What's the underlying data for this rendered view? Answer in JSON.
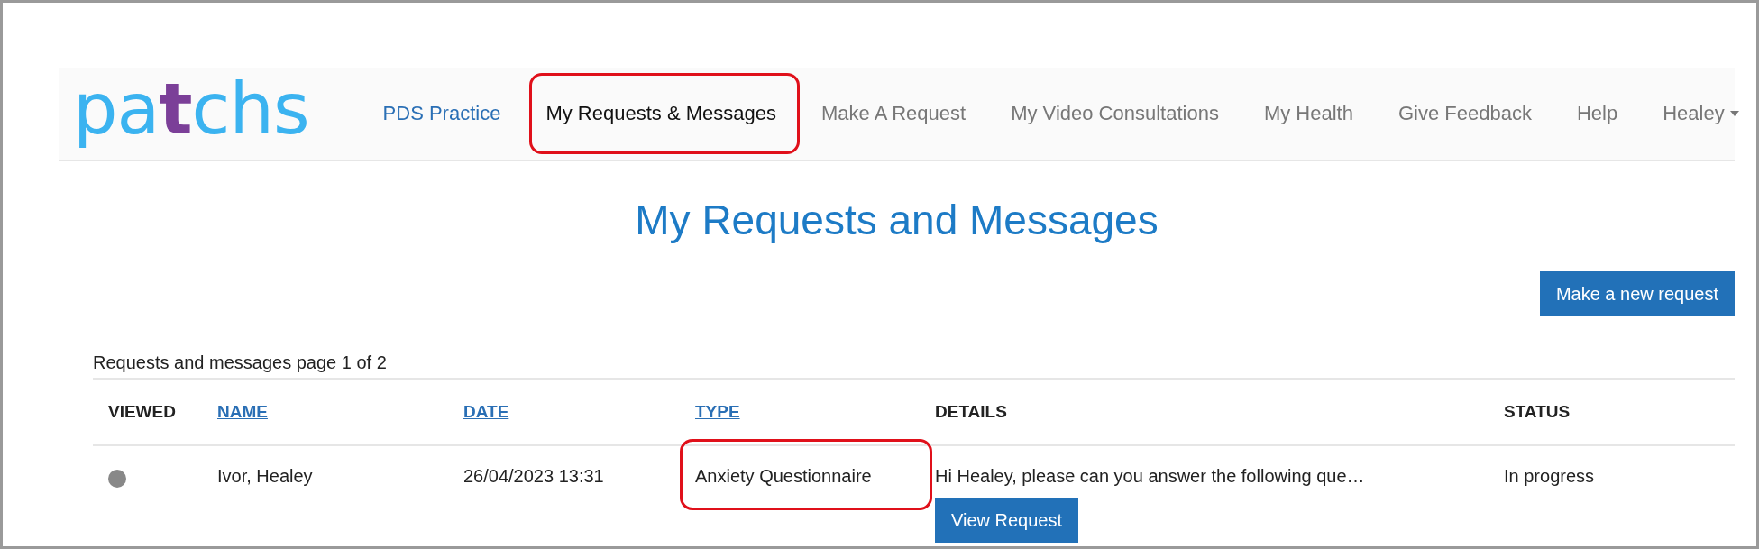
{
  "logo": {
    "parts": [
      "pa",
      "t",
      "chs"
    ]
  },
  "nav": [
    {
      "label": "PDS Practice",
      "kind": "practice",
      "selected": false,
      "highlighted": false
    },
    {
      "label": "My Requests & Messages",
      "kind": "link",
      "selected": true,
      "highlighted": true
    },
    {
      "label": "Make A Request",
      "kind": "link",
      "selected": false,
      "highlighted": false
    },
    {
      "label": "My Video Consultations",
      "kind": "link",
      "selected": false,
      "highlighted": false
    },
    {
      "label": "My Health",
      "kind": "link",
      "selected": false,
      "highlighted": false
    },
    {
      "label": "Give Feedback",
      "kind": "link",
      "selected": false,
      "highlighted": false
    },
    {
      "label": "Help",
      "kind": "link",
      "selected": false,
      "highlighted": false
    },
    {
      "label": "Healey",
      "kind": "dropdown",
      "selected": false,
      "highlighted": false
    }
  ],
  "page_title": "My Requests and Messages",
  "new_request_button": "Make a new request",
  "page_info": "Requests and messages page 1 of 2",
  "table": {
    "columns": [
      {
        "label": "VIEWED",
        "sortable": false
      },
      {
        "label": "NAME",
        "sortable": true
      },
      {
        "label": "DATE",
        "sortable": true
      },
      {
        "label": "TYPE",
        "sortable": true
      },
      {
        "label": "DETAILS",
        "sortable": false
      },
      {
        "label": "STATUS",
        "sortable": false
      }
    ],
    "rows": [
      {
        "color": "#888888",
        "name": "Ivor, Healey",
        "date": "26/04/2023 13:31",
        "type": "Anxiety Questionnaire",
        "type_highlighted": true,
        "details": "Hi Healey, please can you answer the following que…",
        "action": "View Request",
        "status": "In progress"
      }
    ]
  }
}
